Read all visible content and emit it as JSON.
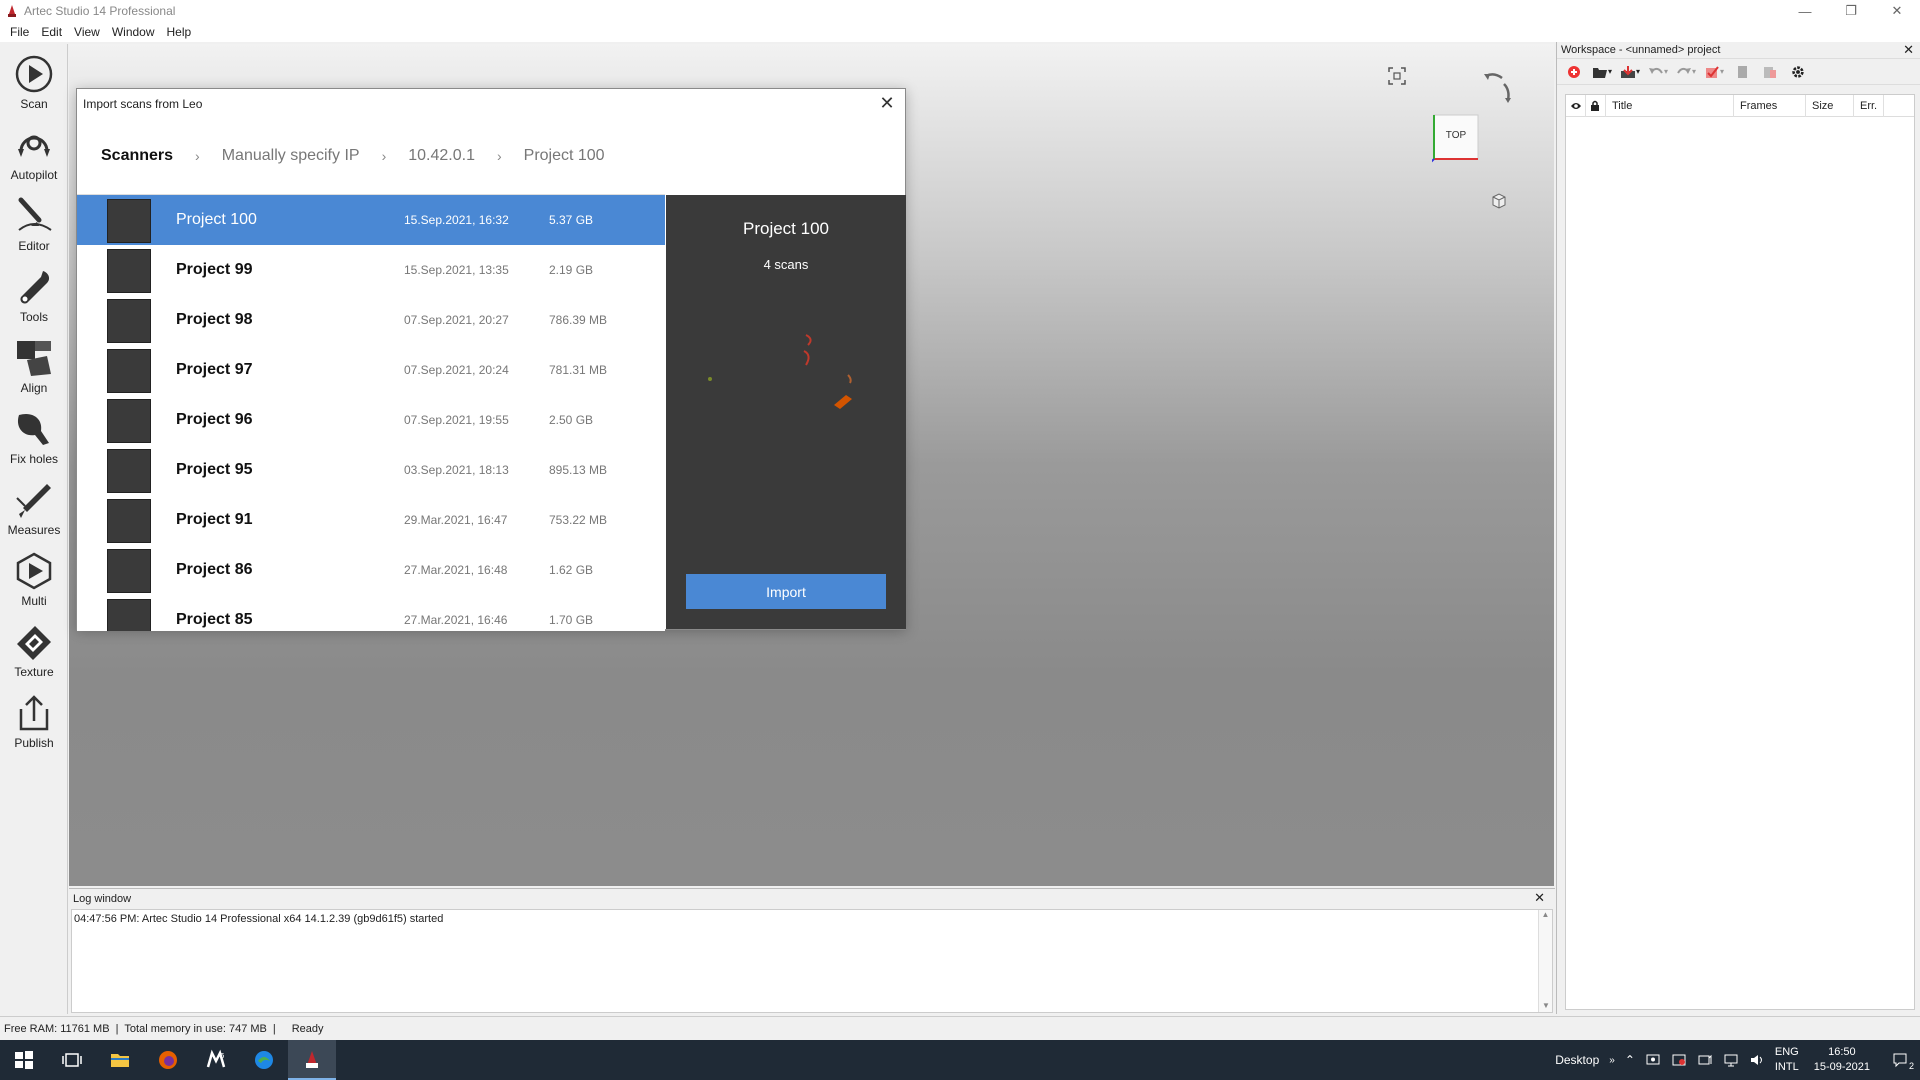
{
  "app": {
    "title": "Artec Studio 14 Professional"
  },
  "menu": [
    "File",
    "Edit",
    "View",
    "Window",
    "Help"
  ],
  "tools": [
    {
      "label": "Scan",
      "icon": "scan-icon"
    },
    {
      "label": "Autopilot",
      "icon": "autopilot-icon"
    },
    {
      "label": "Editor",
      "icon": "editor-icon"
    },
    {
      "label": "Tools",
      "icon": "tools-icon"
    },
    {
      "label": "Align",
      "icon": "align-icon"
    },
    {
      "label": "Fix holes",
      "icon": "fix-holes-icon"
    },
    {
      "label": "Measures",
      "icon": "measures-icon"
    },
    {
      "label": "Multi",
      "icon": "multi-icon"
    },
    {
      "label": "Texture",
      "icon": "texture-icon"
    },
    {
      "label": "Publish",
      "icon": "publish-icon"
    }
  ],
  "viewport": {
    "cube_label": "TOP"
  },
  "dialog": {
    "title": "Import scans from Leo",
    "breadcrumb": [
      "Scanners",
      "Manually specify IP",
      "10.42.0.1",
      "Project 100"
    ],
    "projects": [
      {
        "name": "Project 100",
        "date": "15.Sep.2021, 16:32",
        "size": "5.37 GB"
      },
      {
        "name": "Project 99",
        "date": "15.Sep.2021, 13:35",
        "size": "2.19 GB"
      },
      {
        "name": "Project 98",
        "date": "07.Sep.2021, 20:27",
        "size": "786.39 MB"
      },
      {
        "name": "Project 97",
        "date": "07.Sep.2021, 20:24",
        "size": "781.31 MB"
      },
      {
        "name": "Project 96",
        "date": "07.Sep.2021, 19:55",
        "size": "2.50 GB"
      },
      {
        "name": "Project 95",
        "date": "03.Sep.2021, 18:13",
        "size": "895.13 MB"
      },
      {
        "name": "Project 91",
        "date": "29.Mar.2021, 16:47",
        "size": "753.22 MB"
      },
      {
        "name": "Project 86",
        "date": "27.Mar.2021, 16:48",
        "size": "1.62 GB"
      },
      {
        "name": "Project 85",
        "date": "27.Mar.2021, 16:46",
        "size": "1.70 GB"
      }
    ],
    "preview": {
      "title": "Project 100",
      "subtitle": "4 scans",
      "import_label": "Import"
    }
  },
  "workspace": {
    "title": "Workspace - <unnamed> project",
    "columns": [
      "Title",
      "Frames",
      "Size",
      "Err."
    ]
  },
  "log": {
    "title": "Log window",
    "lines": [
      "04:47:56 PM: Artec Studio 14 Professional x64 14.1.2.39 (gb9d61f5) started"
    ]
  },
  "status": {
    "free_ram": "Free RAM: 11761 MB",
    "sep1": "|",
    "total_memory": "Total memory in use: 747 MB",
    "sep2": "|",
    "state": "Ready"
  },
  "taskbar": {
    "desktop_label": "Desktop",
    "lang_top": "ENG",
    "lang_bottom": "INTL",
    "time": "16:50",
    "date": "15-09-2021",
    "notification_count": "2"
  },
  "colors": {
    "accent": "#4a88d4",
    "taskbar": "#1f2a36",
    "preview_bg": "#3a3a3a"
  }
}
